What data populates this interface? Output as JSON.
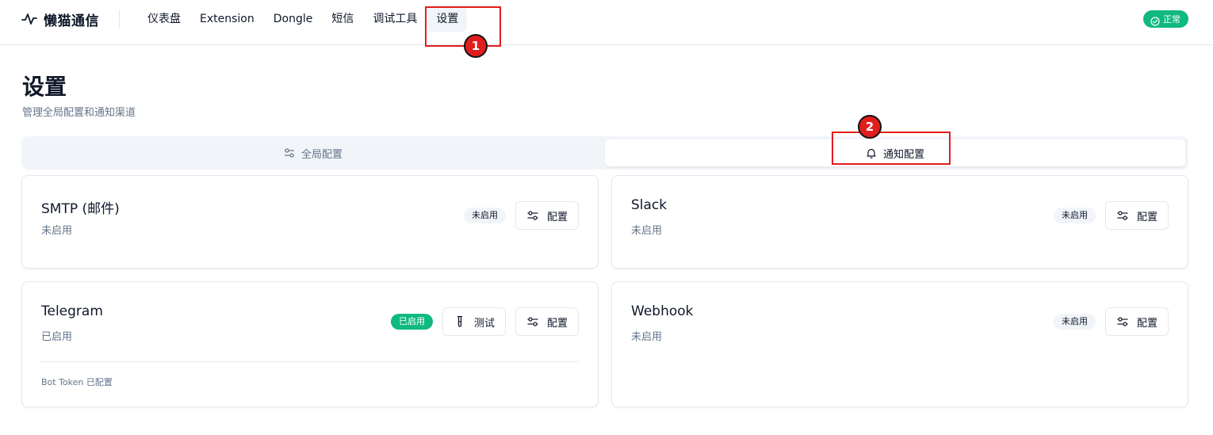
{
  "header": {
    "brand": "懒猫通信",
    "nav": [
      "仪表盘",
      "Extension",
      "Dongle",
      "短信",
      "调试工具",
      "设置"
    ],
    "active_nav_index": 5,
    "status": "正常"
  },
  "page": {
    "title": "设置",
    "subtitle": "管理全局配置和通知渠道"
  },
  "tabs": [
    {
      "label": "全局配置",
      "icon": "sliders-icon",
      "active": false
    },
    {
      "label": "通知配置",
      "icon": "bell-icon",
      "active": true
    }
  ],
  "cards": [
    {
      "title": "SMTP (邮件)",
      "status": "未启用",
      "badge": "未启用",
      "config_label": "配置"
    },
    {
      "title": "Slack",
      "status": "未启用",
      "badge": "未启用",
      "config_label": "配置"
    },
    {
      "title": "Telegram",
      "status": "已启用",
      "badge": "已启用",
      "test_label": "测试",
      "config_label": "配置",
      "note": "Bot Token 已配置"
    },
    {
      "title": "Webhook",
      "status": "未启用",
      "badge": "未启用",
      "config_label": "配置"
    }
  ],
  "annotations": [
    "1",
    "2"
  ],
  "colors": {
    "accent_green": "#10b981",
    "annotation_red": "#e11d1d",
    "muted_text": "#64748b"
  }
}
